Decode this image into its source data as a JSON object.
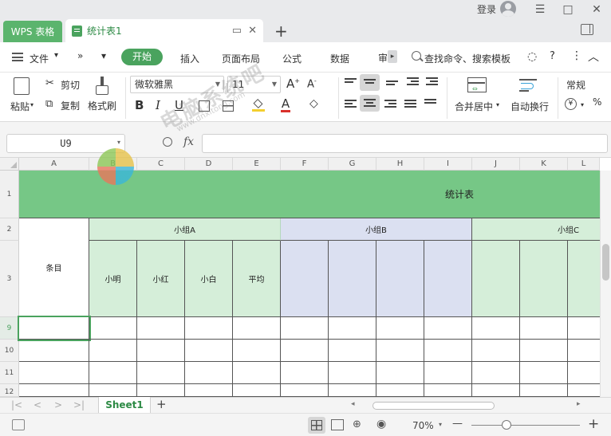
{
  "window": {
    "app_tab": "WPS 表格",
    "doc_tab": "统计表1",
    "login": "登录"
  },
  "menu": {
    "file": "文件",
    "items": [
      "开始",
      "插入",
      "页面布局",
      "公式",
      "数据",
      "审"
    ],
    "search": "查找命令、搜索模板"
  },
  "ribbon": {
    "paste": "粘贴",
    "cut": "剪切",
    "copy": "复制",
    "format_painter": "格式刷",
    "font_name": "微软雅黑",
    "font_size": "11",
    "bold": "B",
    "italic": "I",
    "underline": "U",
    "merge": "合并居中",
    "wrap": "自动换行",
    "number_format": "常规",
    "currency": "¥"
  },
  "formula_bar": {
    "cell_ref": "U9",
    "fx": "fx",
    "value": ""
  },
  "grid": {
    "columns": [
      "A",
      "B",
      "C",
      "D",
      "E",
      "F",
      "G",
      "H",
      "I",
      "J",
      "K",
      "L"
    ],
    "rows": [
      "1",
      "2",
      "3",
      "9",
      "10",
      "11",
      "12"
    ],
    "title": "统计表",
    "row_label": "条目",
    "group_a": "小组A",
    "group_b": "小组B",
    "group_c": "小组C",
    "members": [
      "小明",
      "小红",
      "小白",
      "平均"
    ]
  },
  "sheets": {
    "active": "Sheet1",
    "add": "+"
  },
  "status": {
    "zoom": "70%",
    "minus": "—",
    "plus": "+"
  },
  "colors": {
    "accent": "#4aa35e",
    "title_fill": "#76c786",
    "group_a_fill": "#d5eed9",
    "group_b_fill": "#dbe0f1",
    "group_c_fill": "#d5eed9"
  },
  "watermark": {
    "text": "电脑系统吧",
    "url": "www.dnxitong.com"
  }
}
